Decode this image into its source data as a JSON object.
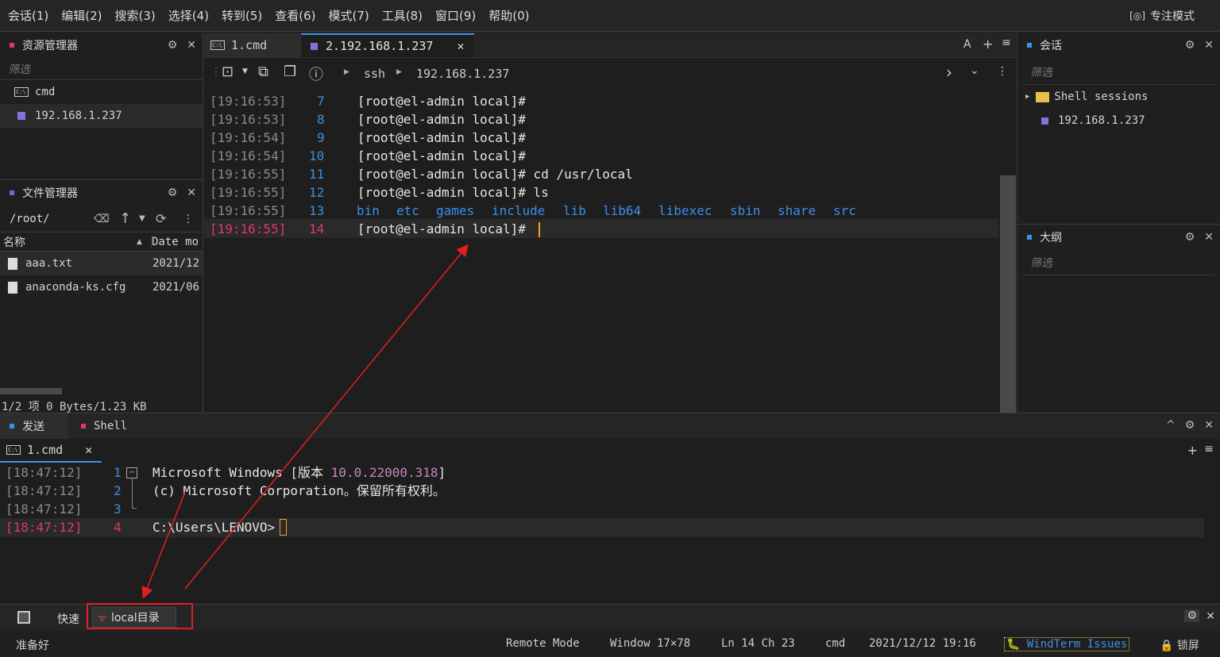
{
  "menu": [
    "会话(1)",
    "编辑(2)",
    "搜索(3)",
    "选择(4)",
    "转到(5)",
    "查看(6)",
    "模式(7)",
    "工具(8)",
    "窗口(9)",
    "帮助(0)"
  ],
  "focus_mode": "专注模式",
  "explorer": {
    "title": "资源管理器",
    "filter": "筛选",
    "items": [
      "cmd",
      "192.168.1.237"
    ]
  },
  "filemgr": {
    "title": "文件管理器",
    "path": "/root/",
    "col_name": "名称",
    "col_date": "Date mo",
    "files": [
      {
        "name": "aaa.txt",
        "date": "2021/12"
      },
      {
        "name": "anaconda-ks.cfg",
        "date": "2021/06"
      }
    ],
    "status": "1/2 项 0 Bytes/1.23 KB"
  },
  "tabs": {
    "tab1": "1.cmd",
    "tab2": "2.192.168.1.237",
    "font_btn": "A"
  },
  "toolbar": {
    "ssh": "ssh",
    "host": "192.168.1.237"
  },
  "terminal": [
    {
      "ts": "[19:16:53]",
      "ln": "7",
      "text": "[root@el-admin local]#"
    },
    {
      "ts": "[19:16:53]",
      "ln": "8",
      "text": "[root@el-admin local]#"
    },
    {
      "ts": "[19:16:54]",
      "ln": "9",
      "text": "[root@el-admin local]#"
    },
    {
      "ts": "[19:16:54]",
      "ln": "10",
      "text": "[root@el-admin local]#"
    },
    {
      "ts": "[19:16:55]",
      "ln": "11",
      "text": "[root@el-admin local]# cd /usr/local"
    },
    {
      "ts": "[19:16:55]",
      "ln": "12",
      "text": "[root@el-admin local]# ls"
    },
    {
      "ts": "[19:16:55]",
      "ln": "13",
      "text": ""
    },
    {
      "ts": "[19:16:55]",
      "ln": "14",
      "text": "[root@el-admin local]#"
    }
  ],
  "ls_output": [
    "bin",
    "etc",
    "games",
    "include",
    "lib",
    "lib64",
    "libexec",
    "sbin",
    "share",
    "src"
  ],
  "sessions": {
    "title": "会话",
    "filter": "筛选",
    "group": "Shell sessions",
    "item": "192.168.1.237"
  },
  "outline": {
    "title": "大纲",
    "filter": "筛选"
  },
  "bottom": {
    "tab_send": "发送",
    "tab_shell": "Shell",
    "subtab": "1.cmd"
  },
  "cmd_lines": [
    {
      "ts": "[18:47:12]",
      "ln": "1"
    },
    {
      "ts": "[18:47:12]",
      "ln": "2",
      "text": "(c) Microsoft Corporation。保留所有权利。"
    },
    {
      "ts": "[18:47:12]",
      "ln": "3",
      "text": ""
    },
    {
      "ts": "[18:47:12]",
      "ln": "4",
      "text": "C:\\Users\\LENOVO>"
    }
  ],
  "cmd_line1": {
    "a": "Microsoft Windows [版本 ",
    "ver": "10.0.22000.318",
    "b": "]"
  },
  "quickbar": {
    "label": "快速",
    "button": "local目录"
  },
  "status": {
    "ready": "准备好",
    "mode": "Remote Mode",
    "window": "Window 17×78",
    "pos": "Ln 14 Ch 23",
    "shell": "cmd",
    "datetime": "2021/12/12 19:16",
    "issues": "WindTerm Issues",
    "lock": "锁屏"
  },
  "colors": {
    "accent": "#3b8eea",
    "annotation": "#e02020",
    "timestamp_active": "#e0376e"
  }
}
